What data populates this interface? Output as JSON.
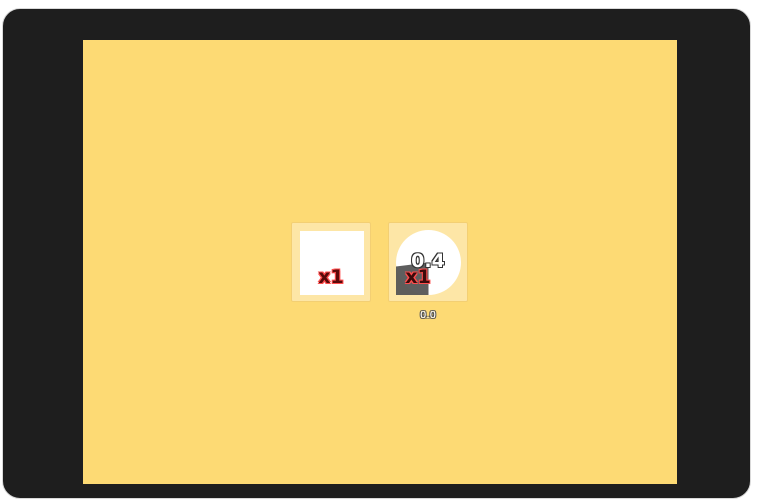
{
  "colors": {
    "frame": "#1e1e1e",
    "frame_border": "#d9d9d9",
    "game_background": "#fdda74",
    "slot_background": "#fde6a6",
    "item_fill": "#ffffff",
    "cooldown_shade": "#555555"
  },
  "inventory": {
    "slots": [
      {
        "item_shape": "square",
        "count_label": "x1"
      },
      {
        "item_shape": "circle",
        "count_label": "x1",
        "cooldown_label": "0.4",
        "cooldown_fraction": 0.25,
        "caption": "0.0"
      }
    ]
  }
}
